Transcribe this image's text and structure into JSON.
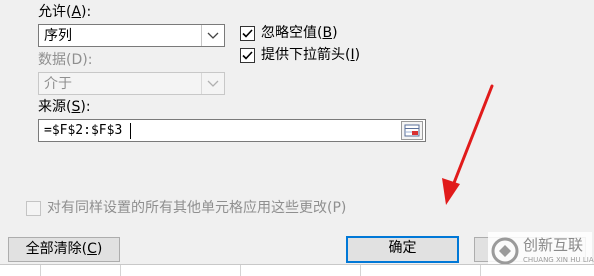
{
  "validation": {
    "allow": {
      "label": "允许(",
      "accel": "A",
      "suffix": "):",
      "value": "序列"
    },
    "ignore_blank": {
      "label": "忽略空值(",
      "accel": "B",
      "suffix": ")",
      "checked": true
    },
    "in_cell_dropdown": {
      "label": "提供下拉箭头(",
      "accel": "I",
      "suffix": ")",
      "checked": true
    },
    "data": {
      "label": "数据(D):",
      "value": "介于",
      "enabled": false
    },
    "source": {
      "label": "来源(",
      "accel": "S",
      "suffix": "):",
      "value": "=$F$2:$F$3"
    },
    "apply_all": {
      "label": "对有同样设置的所有其他单元格应用这些更改(P)",
      "checked": false,
      "enabled": false
    }
  },
  "buttons": {
    "clear_all": {
      "label": "全部清除(",
      "accel": "C",
      "suffix": ")"
    },
    "ok": {
      "label": "确定"
    }
  },
  "watermark": {
    "text_cn": "创新互联",
    "text_en": "CHUANG XIN HU LIAN"
  },
  "colors": {
    "arrow": "#e11b1b",
    "default_button_border": "#0078d7",
    "watermark": "#9a9a9a"
  }
}
